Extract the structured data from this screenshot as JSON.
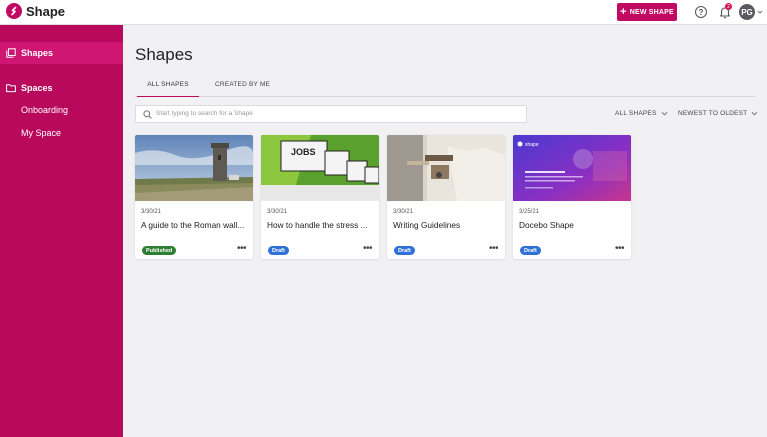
{
  "app": {
    "title": "Shape"
  },
  "header": {
    "new_shape_label": "NEW SHAPE",
    "help_glyph": "?",
    "notification_count": "2",
    "avatar_initials": "PG"
  },
  "sidebar": {
    "items": [
      {
        "label": "Shapes",
        "icon": "shapes-icon",
        "active": true
      },
      {
        "label": "Spaces",
        "icon": "folder-icon"
      },
      {
        "label": "Onboarding"
      },
      {
        "label": "My Space"
      }
    ]
  },
  "main": {
    "title": "Shapes",
    "tabs": [
      {
        "label": "ALL SHAPES",
        "active": true
      },
      {
        "label": "CREATED BY ME"
      }
    ],
    "search": {
      "placeholder": "Start typing to search for a Shape"
    },
    "filters": {
      "type_label": "ALL SHAPES",
      "sort_label": "NEWEST TO OLDEST"
    },
    "cards": [
      {
        "date": "3/30/21",
        "title": "A guide to the Roman wall...",
        "status": "Published"
      },
      {
        "date": "3/30/21",
        "title": "How to handle the stress ...",
        "status": "Draft",
        "thumb_text": "JOBS"
      },
      {
        "date": "3/30/21",
        "title": "Writing Guidelines",
        "status": "Draft"
      },
      {
        "date": "3/25/21",
        "title": "Docebo Shape",
        "status": "Draft",
        "thumb_text": "shape"
      }
    ]
  },
  "colors": {
    "brand": "#b8095c",
    "accent": "#c20a62",
    "published": "#2e7d32",
    "draft": "#2f6fd6"
  }
}
